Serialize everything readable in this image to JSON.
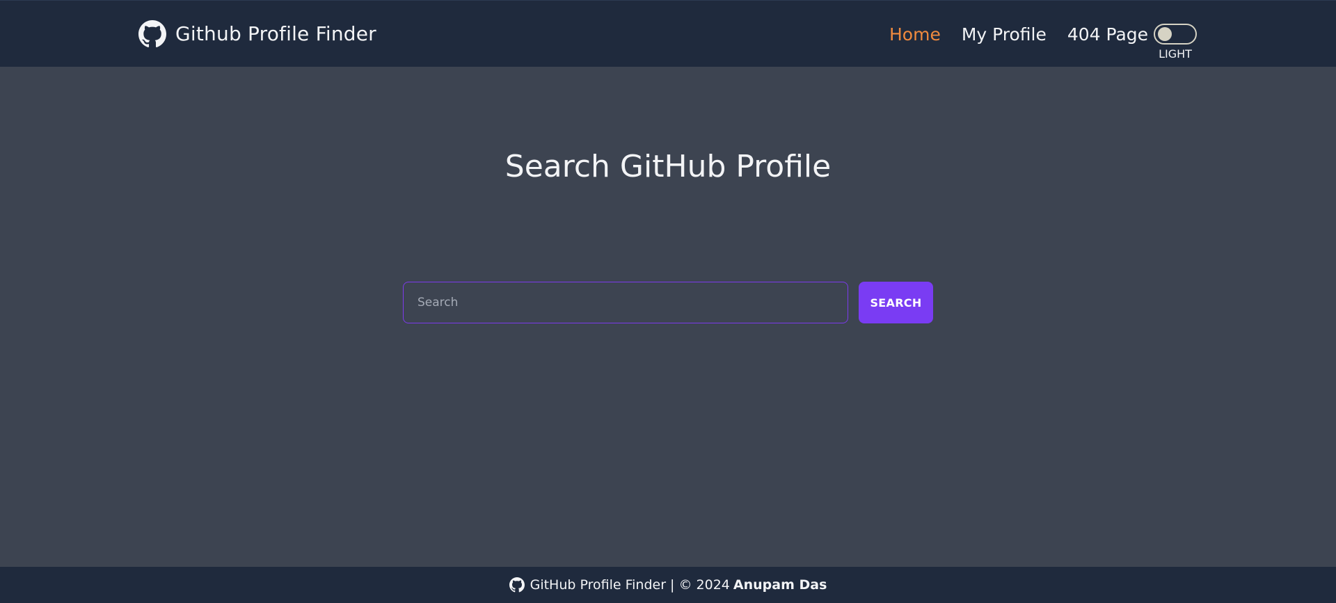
{
  "navbar": {
    "brand_icon": "github-icon",
    "brand_title": "Github Profile Finder",
    "links": [
      {
        "label": "Home",
        "active": true
      },
      {
        "label": "My Profile",
        "active": false
      },
      {
        "label": "404 Page",
        "active": false
      }
    ],
    "theme_toggle": {
      "label": "LIGHT",
      "checked": false
    }
  },
  "main": {
    "title": "Search GitHub Profile",
    "search": {
      "placeholder": "Search",
      "value": "",
      "button_label": "SEARCH"
    }
  },
  "footer": {
    "icon": "github-icon",
    "text": "GitHub Profile Finder | © 2024",
    "author": "Anupam Das"
  },
  "colors": {
    "navbar_bg": "#1f2a3d",
    "page_bg": "#3d4451",
    "accent": "#7a3cf3",
    "active_link": "#f08a3e"
  }
}
